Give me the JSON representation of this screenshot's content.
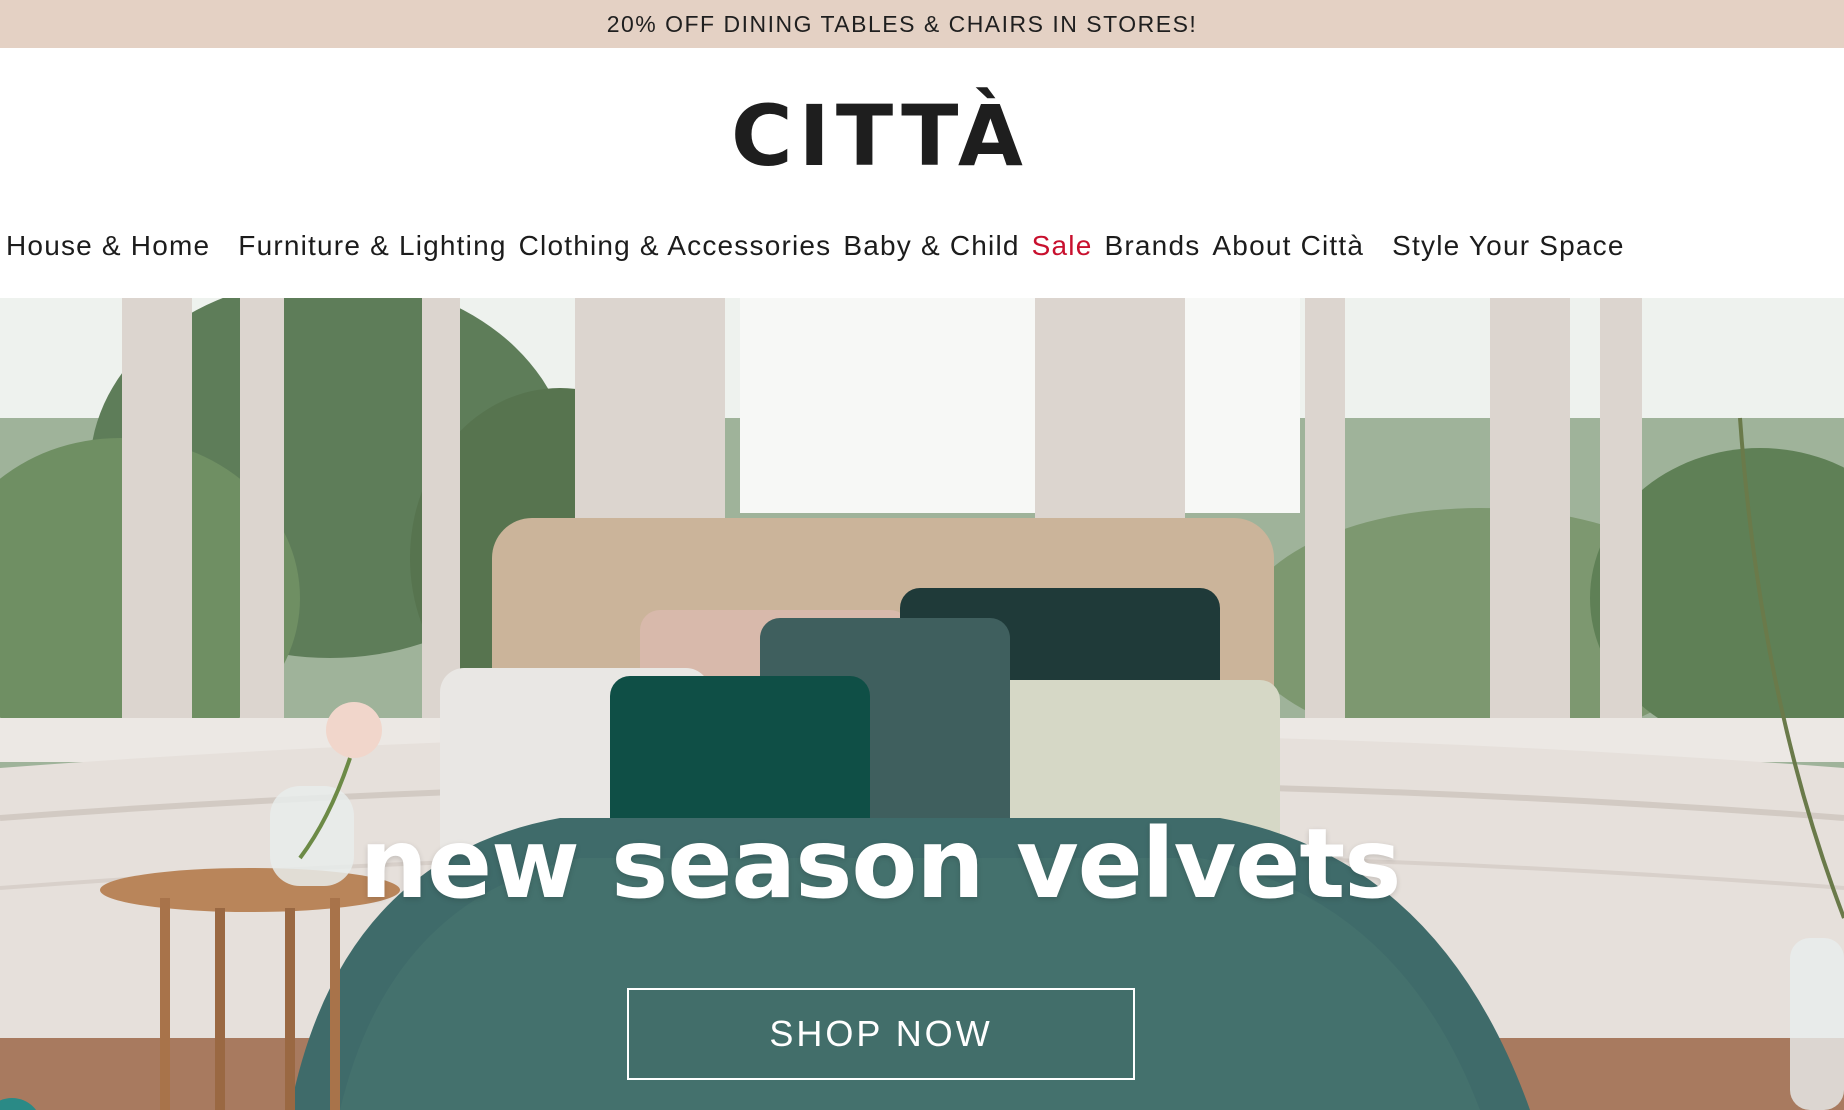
{
  "promo": {
    "text": "20% OFF DINING TABLES & CHAIRS IN STORES!"
  },
  "header": {
    "logo": "CITTÀ"
  },
  "nav": {
    "items": [
      {
        "label": "House & Home"
      },
      {
        "label": "Furniture & Lighting"
      },
      {
        "label": "Clothing & Accessories"
      },
      {
        "label": "Baby & Child"
      },
      {
        "label": "Sale"
      },
      {
        "label": "Brands"
      },
      {
        "label": "About Città"
      },
      {
        "label": "Style Your Space"
      }
    ]
  },
  "hero": {
    "title": "new season velvets",
    "cta": "SHOP NOW"
  },
  "colors": {
    "promo_bg": "#e4d1c4",
    "sale": "#c8102e",
    "velvet_teal": "#3f6b6a"
  }
}
